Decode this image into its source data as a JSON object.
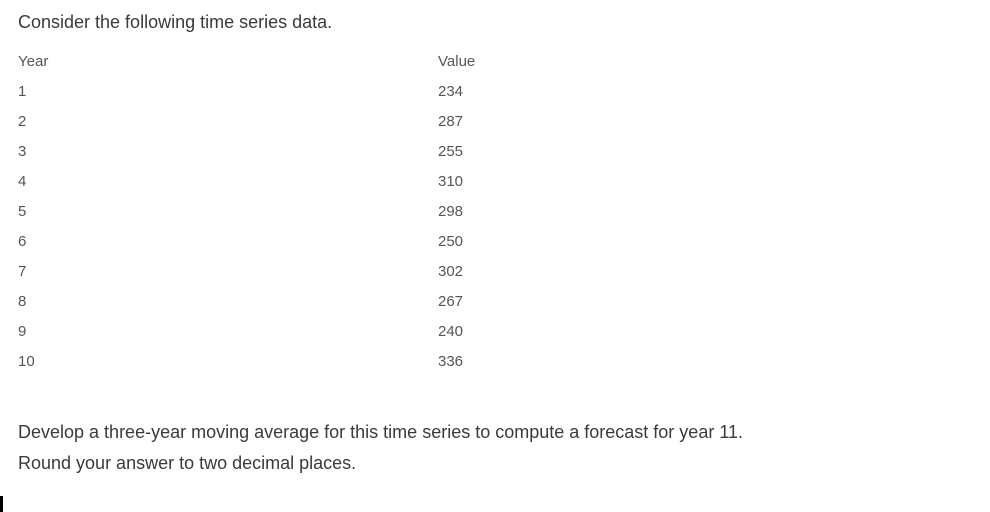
{
  "intro": "Consider the following time series data.",
  "table": {
    "headers": {
      "year": "Year",
      "value": "Value"
    },
    "rows": [
      {
        "year": "1",
        "value": "234"
      },
      {
        "year": "2",
        "value": "287"
      },
      {
        "year": "3",
        "value": "255"
      },
      {
        "year": "4",
        "value": "310"
      },
      {
        "year": "5",
        "value": "298"
      },
      {
        "year": "6",
        "value": "250"
      },
      {
        "year": "7",
        "value": "302"
      },
      {
        "year": "8",
        "value": "267"
      },
      {
        "year": "9",
        "value": "240"
      },
      {
        "year": "10",
        "value": "336"
      }
    ]
  },
  "question_line1": "Develop a three-year moving average for this time series to compute a forecast for year 11.",
  "question_line2": "Round your answer to two decimal places.",
  "chart_data": {
    "type": "table",
    "columns": [
      "Year",
      "Value"
    ],
    "rows": [
      [
        1,
        234
      ],
      [
        2,
        287
      ],
      [
        3,
        255
      ],
      [
        4,
        310
      ],
      [
        5,
        298
      ],
      [
        6,
        250
      ],
      [
        7,
        302
      ],
      [
        8,
        267
      ],
      [
        9,
        240
      ],
      [
        10,
        336
      ]
    ]
  }
}
